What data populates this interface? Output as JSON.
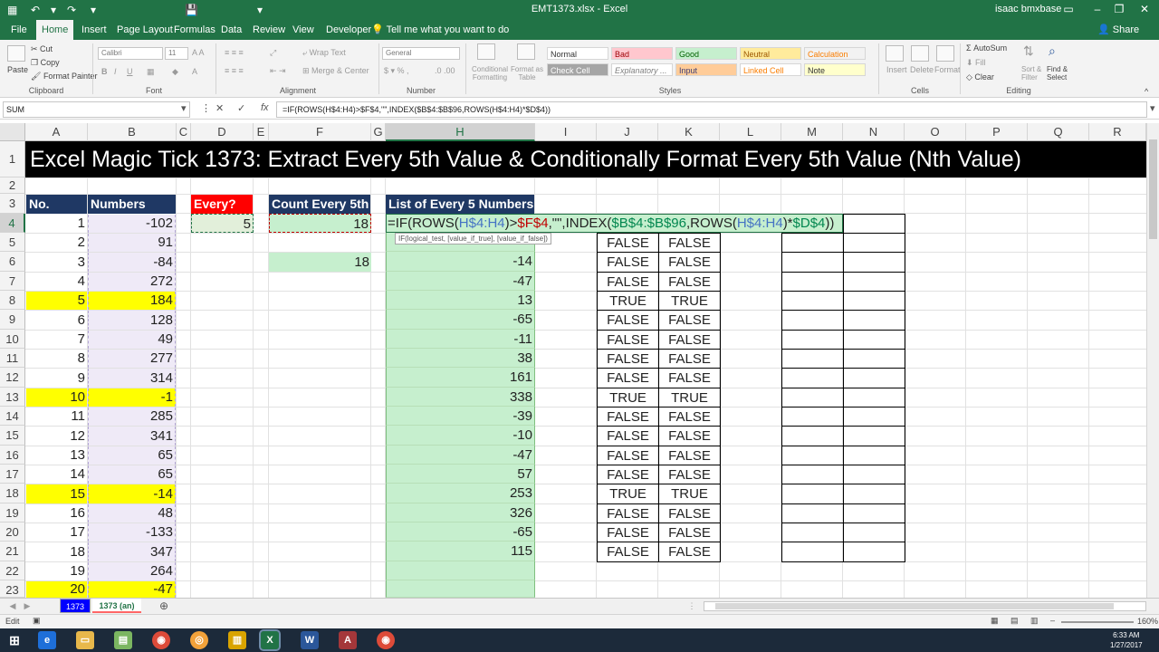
{
  "window": {
    "title": "EMT1373.xlsx - Excel",
    "user": "isaac bmxbase",
    "share_label": "Share",
    "tell_me": "Tell me what you want to do"
  },
  "ribbon_tabs": [
    "File",
    "Home",
    "Insert",
    "Page Layout",
    "Formulas",
    "Data",
    "Review",
    "View",
    "Developer"
  ],
  "ribbon": {
    "clipboard": {
      "paste": "Paste",
      "cut": "Cut",
      "copy": "Copy",
      "format_painter": "Format Painter",
      "label": "Clipboard"
    },
    "font": {
      "name": "Calibri",
      "size": "11",
      "label": "Font"
    },
    "alignment": {
      "wrap": "Wrap Text",
      "merge": "Merge & Center",
      "label": "Alignment"
    },
    "number": {
      "format": "General",
      "label": "Number"
    },
    "styles_buttons": {
      "conditional": "Conditional Formatting",
      "format_table": "Format as Table"
    },
    "styles": {
      "normal": "Normal",
      "bad": "Bad",
      "good": "Good",
      "neutral": "Neutral",
      "calculation": "Calculation",
      "check_cell": "Check Cell",
      "explanatory": "Explanatory ...",
      "input": "Input",
      "linked_cell": "Linked Cell",
      "note": "Note",
      "label": "Styles"
    },
    "cells": {
      "insert": "Insert",
      "delete": "Delete",
      "format": "Format",
      "label": "Cells"
    },
    "editing": {
      "autosum": "AutoSum",
      "fill": "Fill",
      "clear": "Clear",
      "sort": "Sort & Filter",
      "find": "Find & Select",
      "label": "Editing"
    }
  },
  "formula_bar": {
    "name_box": "SUM",
    "formula": "=IF(ROWS(H$4:H4)>$F$4,\"\",INDEX($B$4:$B$96,ROWS(H$4:H4)*$D$4))"
  },
  "columns": [
    "A",
    "B",
    "C",
    "D",
    "E",
    "F",
    "G",
    "H",
    "I",
    "J",
    "K",
    "L",
    "M",
    "N",
    "O",
    "P",
    "Q",
    "R"
  ],
  "rows": [
    "1",
    "2",
    "3",
    "4",
    "5",
    "6",
    "7",
    "8",
    "9",
    "10",
    "11",
    "12",
    "13",
    "14",
    "15",
    "16",
    "17",
    "18",
    "19",
    "20",
    "21",
    "22",
    "23"
  ],
  "sheet": {
    "banner": "Excel Magic Tick 1373: Extract Every 5th Value & Conditionally Format Every 5th Value (Nth Value)",
    "headers": {
      "no": "No.",
      "numbers": "Numbers",
      "every": "Every?",
      "count": "Count Every 5th",
      "list": "List of Every 5 Numbers"
    },
    "every_value": "5",
    "count_value": "18",
    "count_value_2": "18",
    "no_values": [
      "1",
      "2",
      "3",
      "4",
      "5",
      "6",
      "7",
      "8",
      "9",
      "10",
      "11",
      "12",
      "13",
      "14",
      "15",
      "16",
      "17",
      "18",
      "19",
      "20"
    ],
    "number_values": [
      "-102",
      "91",
      "-84",
      "272",
      "184",
      "128",
      "49",
      "277",
      "314",
      "-1",
      "285",
      "341",
      "65",
      "65",
      "-14",
      "48",
      "-133",
      "347",
      "264",
      "-47"
    ],
    "list_values": [
      "-14",
      "-47",
      "13",
      "-65",
      "-11",
      "38",
      "161",
      "338",
      "-39",
      "-10",
      "-47",
      "57",
      "253",
      "326",
      "-65",
      "115"
    ],
    "bool_j": [
      "FALSE",
      "FALSE",
      "FALSE",
      "TRUE",
      "FALSE",
      "FALSE",
      "FALSE",
      "FALSE",
      "TRUE",
      "FALSE",
      "FALSE",
      "FALSE",
      "FALSE",
      "TRUE",
      "FALSE",
      "FALSE",
      "FALSE"
    ],
    "bool_k": [
      "FALSE",
      "FALSE",
      "FALSE",
      "TRUE",
      "FALSE",
      "FALSE",
      "FALSE",
      "FALSE",
      "TRUE",
      "FALSE",
      "FALSE",
      "FALSE",
      "FALSE",
      "TRUE",
      "FALSE",
      "FALSE",
      "FALSE"
    ],
    "edit": {
      "p1": "=IF(",
      "p2": "ROWS(",
      "p3": "H$4:H4",
      "p4": ")>",
      "p5": "$F$4",
      "p6": ",\"\",INDEX(",
      "p7": "$B$4:$B$96",
      "p8": ",ROWS(",
      "p9": "H$4:H4",
      "p10": ")*",
      "p11": "$D$4",
      "p12": "))"
    },
    "tooltip": "IF(logical_test, [value_if_true], [value_if_false])"
  },
  "sheet_tabs": {
    "tab1": "1373",
    "tab2": "1373 (an)"
  },
  "status": {
    "mode": "Edit",
    "zoom": "160%"
  },
  "clock": {
    "time": "6:33 AM",
    "date": "1/27/2017"
  },
  "colors": {
    "excel_green": "#217346",
    "header_navy": "#1f3864",
    "highlight_yellow": "#ffff00",
    "light_green": "#c6efce",
    "lavender": "#efeaf7",
    "red_header": "#ff0000"
  }
}
